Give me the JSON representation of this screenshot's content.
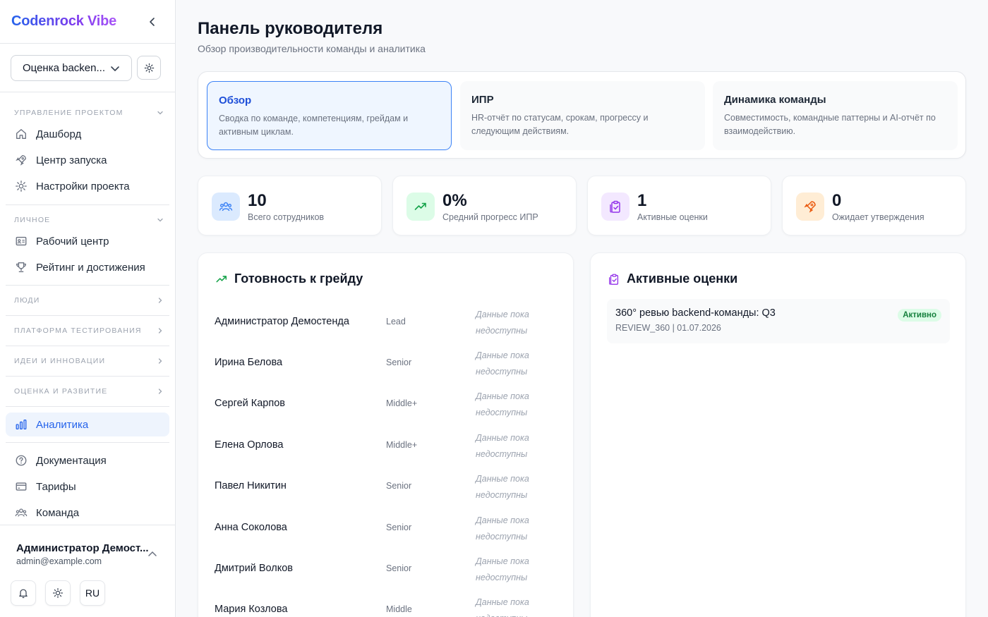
{
  "brand": "Codenrock Vibe",
  "project_select": {
    "value": "Оценка backen..."
  },
  "sidebar": {
    "sections": [
      {
        "title": "Управление проектом",
        "items": [
          {
            "label": "Дашборд",
            "icon": "home-icon"
          },
          {
            "label": "Центр запуска",
            "icon": "rocket-icon"
          },
          {
            "label": "Настройки проекта",
            "icon": "gear-icon"
          }
        ]
      },
      {
        "title": "Личное",
        "items": [
          {
            "label": "Рабочий центр",
            "icon": "id-card-icon"
          },
          {
            "label": "Рейтинг и достижения",
            "icon": "trophy-icon"
          }
        ]
      },
      {
        "title": "Люди"
      },
      {
        "title": "Платформа тестирования"
      },
      {
        "title": "Идеи и инновации"
      },
      {
        "title": "Оценка и развитие"
      }
    ],
    "active_item": {
      "label": "Аналитика",
      "icon": "bar-chart-icon"
    },
    "footer_items": [
      {
        "label": "Документация",
        "icon": "help-circle-icon"
      },
      {
        "label": "Тарифы",
        "icon": "credit-card-icon"
      },
      {
        "label": "Команда",
        "icon": "users-icon"
      }
    ],
    "user": {
      "name": "Администратор Демост...",
      "email": "admin@example.com"
    },
    "lang": "RU"
  },
  "page": {
    "title": "Панель руководителя",
    "subtitle": "Обзор производительности команды и аналитика"
  },
  "tabs": [
    {
      "title": "Обзор",
      "desc": "Сводка по команде, компетенциям, грейдам и активным циклам."
    },
    {
      "title": "ИПР",
      "desc": "HR-отчёт по статусам, срокам, прогрессу и следующим действиям."
    },
    {
      "title": "Динамика команды",
      "desc": "Совместимость, командные паттерны и AI-отчёт по взаимодействию."
    }
  ],
  "stats": [
    {
      "value": "10",
      "label": "Всего сотрудников",
      "icon": "users-icon",
      "color": "#3b82f6",
      "bg": "#dbeafe"
    },
    {
      "value": "0%",
      "label": "Средний прогресс ИПР",
      "icon": "trending-up-icon",
      "color": "#16a34a",
      "bg": "#dcfce7"
    },
    {
      "value": "1",
      "label": "Активные оценки",
      "icon": "clipboard-check-icon",
      "color": "#9333ea",
      "bg": "#f3e8ff"
    },
    {
      "value": "0",
      "label": "Ожидает утверждения",
      "icon": "rocket-icon",
      "color": "#ea580c",
      "bg": "#ffedd5"
    }
  ],
  "grade_panel": {
    "title": "Готовность к грейду",
    "rows": [
      {
        "name": "Администратор Демостенда",
        "level": "Lead",
        "status": "Данные пока недоступны"
      },
      {
        "name": "Ирина Белова",
        "level": "Senior",
        "status": "Данные пока недоступны"
      },
      {
        "name": "Сергей Карпов",
        "level": "Middle+",
        "status": "Данные пока недоступны"
      },
      {
        "name": "Елена Орлова",
        "level": "Middle+",
        "status": "Данные пока недоступны"
      },
      {
        "name": "Павел Никитин",
        "level": "Senior",
        "status": "Данные пока недоступны"
      },
      {
        "name": "Анна Соколова",
        "level": "Senior",
        "status": "Данные пока недоступны"
      },
      {
        "name": "Дмитрий Волков",
        "level": "Senior",
        "status": "Данные пока недоступны"
      },
      {
        "name": "Мария Козлова",
        "level": "Middle",
        "status": "Данные пока недоступны"
      }
    ]
  },
  "reviews_panel": {
    "title": "Активные оценки",
    "items": [
      {
        "title": "360° ревью backend-команды: Q3",
        "meta": "REVIEW_360 | 01.07.2026",
        "badge": "Активно"
      }
    ]
  }
}
